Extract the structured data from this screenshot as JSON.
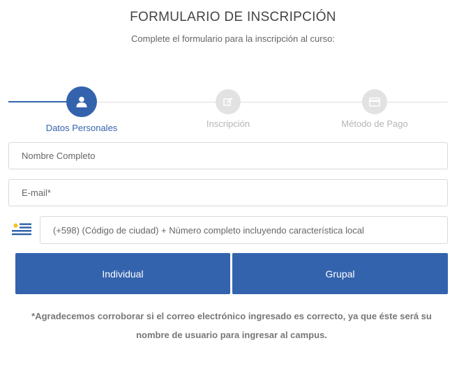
{
  "header": {
    "title": "FORMULARIO DE INSCRIPCIÓN",
    "subtitle": "Complete el formulario para la inscripción al curso:"
  },
  "stepper": {
    "steps": [
      {
        "label": "Datos Personales",
        "icon": "user-icon",
        "active": true
      },
      {
        "label": "Inscripción",
        "icon": "edit-icon",
        "active": false
      },
      {
        "label": "Método de Pago",
        "icon": "credit-card-icon",
        "active": false
      }
    ]
  },
  "form": {
    "name_placeholder": "Nombre Completo",
    "email_placeholder": "E-mail*",
    "phone_placeholder": "(+598) (Código de ciudad) + Número completo incluyendo característica local",
    "phone_flag": "uruguay-flag-icon"
  },
  "buttons": {
    "individual_label": "Individual",
    "grupal_label": "Grupal"
  },
  "note": {
    "line1": "*Agradecemos corroborar si el correo electrónico ingresado es correcto, ya que éste será su",
    "line2": "nombre de usuario para ingresar al campus."
  },
  "colors": {
    "primary": "#3463ae",
    "inactive_step": "#e2e2e2",
    "inactive_label": "#b5b5b5"
  }
}
